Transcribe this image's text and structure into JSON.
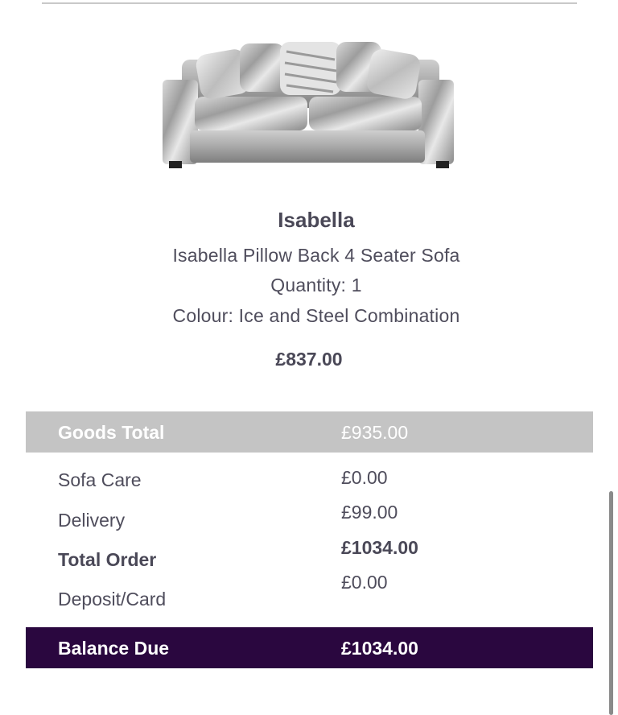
{
  "product": {
    "name": "Isabella",
    "description": "Isabella Pillow Back 4 Seater Sofa",
    "quantity": "Quantity: 1",
    "colour": "Colour: Ice and Steel Combination",
    "price": "£837.00",
    "image_icon": "sofa-image"
  },
  "summary": {
    "goods_total_label": "Goods Total",
    "goods_total_value": "£935.00",
    "rows": [
      {
        "label": "Sofa Care",
        "value": "£0.00"
      },
      {
        "label": "Delivery",
        "value": "£99.00"
      },
      {
        "label": "Total Order",
        "value": "£1034.00"
      },
      {
        "label": "Deposit/Card",
        "value": "£0.00"
      }
    ],
    "balance_label": "Balance Due",
    "balance_value": "£1034.00"
  },
  "colors": {
    "goods_bar": "#c4c4c4",
    "balance_bar": "#2a073f",
    "text": "#4a4857"
  }
}
